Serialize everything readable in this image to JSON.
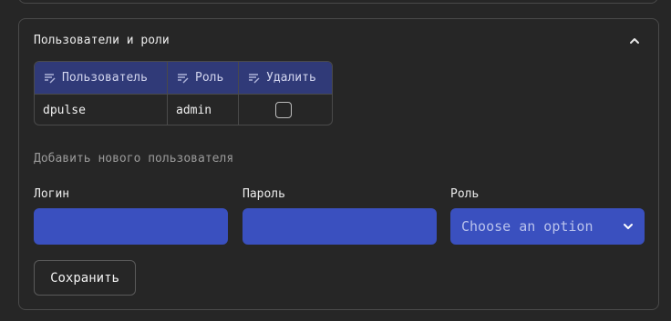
{
  "section": {
    "title": "Пользователи и роли"
  },
  "users_table": {
    "columns": [
      "Пользователь",
      "Роль",
      "Удалить"
    ],
    "rows": [
      {
        "user": "dpulse",
        "role": "admin",
        "delete_checked": false
      }
    ]
  },
  "add_user": {
    "heading": "Добавить нового пользователя",
    "login_label": "Логин",
    "login_value": "",
    "password_label": "Пароль",
    "password_value": "",
    "role_label": "Роль",
    "role_placeholder": "Choose an option"
  },
  "save_label": "Сохранить",
  "colors": {
    "background": "#262626",
    "table_header": "#303a78",
    "input_fill": "#3a50bf",
    "border": "#4a4a4a"
  },
  "icons": {
    "collapse": "chevron-up-icon",
    "column_sort": "edit-lines-icon",
    "select_arrow": "chevron-down-icon"
  }
}
